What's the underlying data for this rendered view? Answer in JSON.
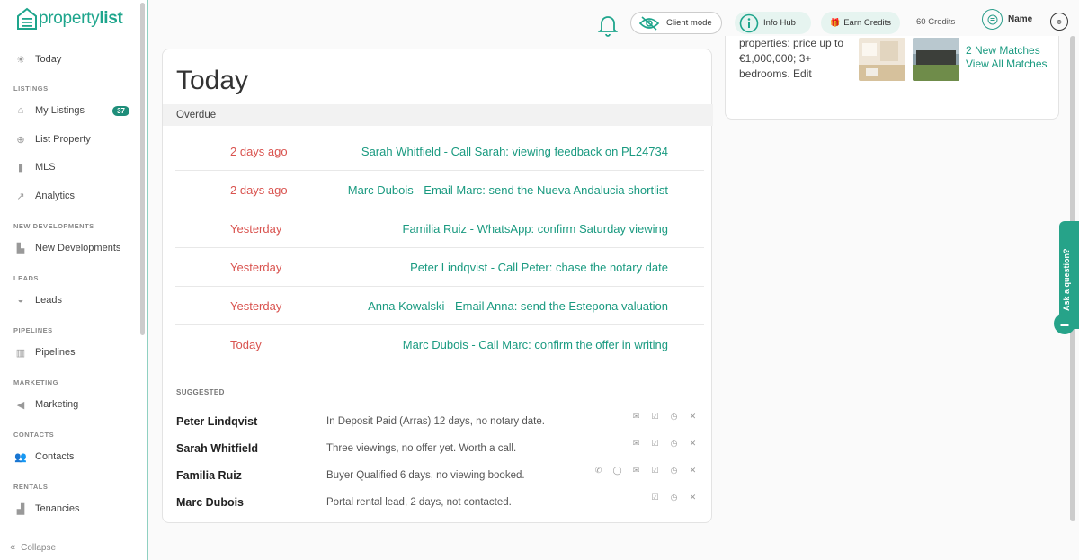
{
  "brand": {
    "name_light": "property",
    "name_bold": "list"
  },
  "sidebar": {
    "items": [
      {
        "label": "Today",
        "icon": "sun-icon"
      },
      {
        "section": "LISTINGS"
      },
      {
        "label": "My Listings",
        "icon": "home-icon",
        "badge": "37"
      },
      {
        "label": "List Property",
        "icon": "plus-circle-icon"
      },
      {
        "label": "MLS",
        "icon": "bar-chart-icon"
      },
      {
        "label": "Analytics",
        "icon": "trend-icon"
      },
      {
        "section": "NEW DEVELOPMENTS"
      },
      {
        "label": "New Developments",
        "icon": "building-icon"
      },
      {
        "section": "LEADS"
      },
      {
        "label": "Leads",
        "icon": "inbox-icon"
      },
      {
        "section": "PIPELINES"
      },
      {
        "label": "Pipelines",
        "icon": "kanban-icon"
      },
      {
        "section": "MARKETING"
      },
      {
        "label": "Marketing",
        "icon": "megaphone-icon"
      },
      {
        "section": "CONTACTS"
      },
      {
        "label": "Contacts",
        "icon": "people-icon"
      },
      {
        "section": "RENTALS"
      },
      {
        "label": "Tenancies",
        "icon": "key-icon"
      }
    ],
    "collapse_label": "Collapse"
  },
  "topbar": {
    "client_mode": "Client mode",
    "info_hub": "Info Hub",
    "earn_credits": "Earn Credits",
    "credits": "60 Credits",
    "user_name": "Name"
  },
  "main": {
    "title": "Today",
    "overdue_label": "Overdue",
    "tasks": [
      {
        "when": "2 days ago",
        "what": "Sarah Whitfield - Call Sarah: viewing feedback on PL24734"
      },
      {
        "when": "2 days ago",
        "what": "Marc Dubois - Email Marc: send the Nueva Andalucia shortlist"
      },
      {
        "when": "Yesterday",
        "what": "Familia Ruiz - WhatsApp: confirm Saturday viewing"
      },
      {
        "when": "Yesterday",
        "what": "Peter Lindqvist - Call Peter: chase the notary date"
      },
      {
        "when": "Yesterday",
        "what": "Anna Kowalski - Email Anna: send the Estepona valuation"
      },
      {
        "when": "Today",
        "what": "Marc Dubois - Call Marc: confirm the offer in writing"
      }
    ],
    "suggested_label": "SUGGESTED",
    "suggested": [
      {
        "name": "Peter Lindqvist",
        "note": "In Deposit Paid (Arras) 12 days, no notary date."
      },
      {
        "name": "Sarah Whitfield",
        "note": "Three viewings, no offer yet. Worth a call."
      },
      {
        "name": "Familia Ruiz",
        "note": "Buyer Qualified 6 days, no viewing booked."
      },
      {
        "name": "Marc Dubois",
        "note": "Portal rental lead, 2 days, not contacted."
      }
    ]
  },
  "right_panel": {
    "search_text": "properties: price up to €1,000,000; 3+ bedrooms.",
    "edit_label": "Edit",
    "new_matches": "2 New Matches",
    "view_all": "View All Matches"
  },
  "ask_question": "Ask a question?"
}
